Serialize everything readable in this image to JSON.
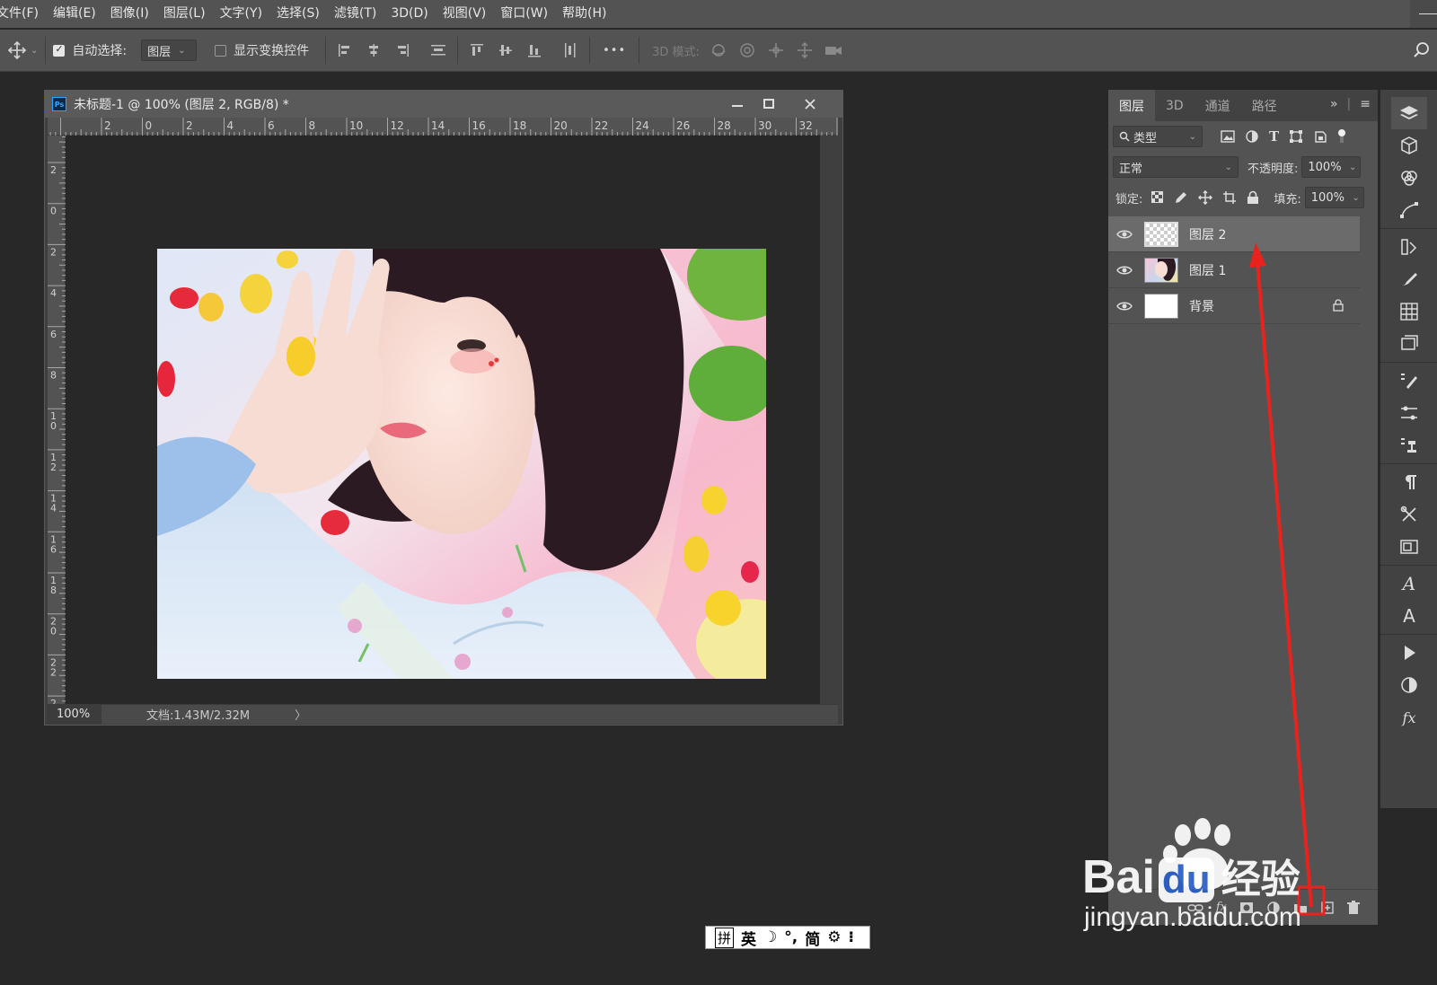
{
  "menubar": {
    "items": [
      "文件(F)",
      "编辑(E)",
      "图像(I)",
      "图层(L)",
      "文字(Y)",
      "选择(S)",
      "滤镜(T)",
      "3D(D)",
      "视图(V)",
      "窗口(W)",
      "帮助(H)"
    ]
  },
  "options": {
    "auto_select_label": "自动选择:",
    "auto_select_value": "图层",
    "show_transform_label": "显示变换控件",
    "more": "•••",
    "mode_3d_label": "3D 模式:"
  },
  "document": {
    "title": "未标题-1 @ 100% (图层 2, RGB/8) *",
    "ps_badge": "Ps",
    "ruler_top_labels": [
      "2",
      "0",
      "2",
      "4",
      "6",
      "8",
      "10",
      "12",
      "14",
      "16",
      "18",
      "20",
      "22",
      "24",
      "26",
      "28",
      "30",
      "32"
    ],
    "ruler_left_labels": [
      "2",
      "0",
      "2",
      "4",
      "6",
      "8",
      "1\n0",
      "1\n2",
      "1\n4",
      "1\n6",
      "1\n8",
      "2\n0",
      "2\n2",
      "2"
    ],
    "zoom": "100%",
    "doc_info": "文档:1.43M/2.32M",
    "status_arrow": "〉"
  },
  "layers_panel": {
    "tabs": [
      "图层",
      "3D",
      "通道",
      "路径"
    ],
    "filter_label": "类型",
    "blend_mode": "正常",
    "opacity_label": "不透明度:",
    "opacity_value": "100%",
    "lock_label": "锁定:",
    "fill_label": "填充:",
    "fill_value": "100%",
    "layers": [
      {
        "name": "图层 2",
        "thumb": "transparent",
        "selected": true
      },
      {
        "name": "图层 1",
        "thumb": "photo",
        "selected": false
      },
      {
        "name": "背景",
        "thumb": "white",
        "selected": false,
        "locked": true
      }
    ],
    "footer_fx": "fx"
  },
  "watermark": {
    "logo_bai": "Bai",
    "logo_du": "du",
    "logo_cn": "经验",
    "url": "jingyan.baidu.com"
  },
  "ime": {
    "items": [
      "拼",
      "英",
      "简"
    ]
  },
  "colors": {
    "accent_arrow": "#e8231d",
    "selected_layer": "#6b6b6b",
    "ps_blue": "#31a8ff"
  }
}
